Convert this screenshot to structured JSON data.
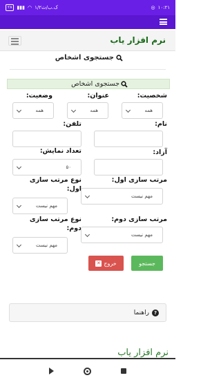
{
  "status_bar": {
    "time": "۱۰:۲۱",
    "network_speed": "۱/۲ک.ب/ث",
    "battery": "۲۸"
  },
  "brand": "نرم افزار یاب",
  "page_heading": "جستجوی اشخاص",
  "section_title": "جستجوی اشخاص",
  "form": {
    "personality": {
      "label": "شخصیت:",
      "value": "همه"
    },
    "title": {
      "label": "عنوان:",
      "value": "همه"
    },
    "status": {
      "label": "وضعیت:",
      "value": "همه"
    },
    "name": {
      "label": "نام:",
      "value": ""
    },
    "phone": {
      "label": "تلفن:",
      "value": ""
    },
    "free": {
      "label": "آزاد:",
      "value": ""
    },
    "display_count": {
      "label": "تعداد نمایش:",
      "value": "۵۰"
    },
    "sort_first": {
      "label": "مرتب سازی اول:",
      "value": "مهم نیست"
    },
    "sort_first_type": {
      "label_line1": "نوع مرتب سازی",
      "label_line2": "اول:",
      "value": "مهم نیست"
    },
    "sort_second": {
      "label": "مرتب سازی دوم:",
      "value": "مهم نیست"
    },
    "sort_second_type": {
      "label_line1": "نوع مرتب سازی",
      "label_line2": "دوم:",
      "value": "مهم نیست"
    }
  },
  "buttons": {
    "search": "جستجو",
    "exit": "خروج"
  },
  "help": "راهنما",
  "footer_brand": "نرم افزار یاب",
  "colors": {
    "status_bar": "#6a1fe6",
    "brand": "#1a6b1a",
    "search_button": "#5cb85c",
    "exit_button": "#d9534f",
    "section_bar": "#e6f2e0"
  },
  "icons": [
    "search-icon",
    "info-icon",
    "close-icon",
    "hamburger-icon",
    "chevron-down-icon"
  ]
}
